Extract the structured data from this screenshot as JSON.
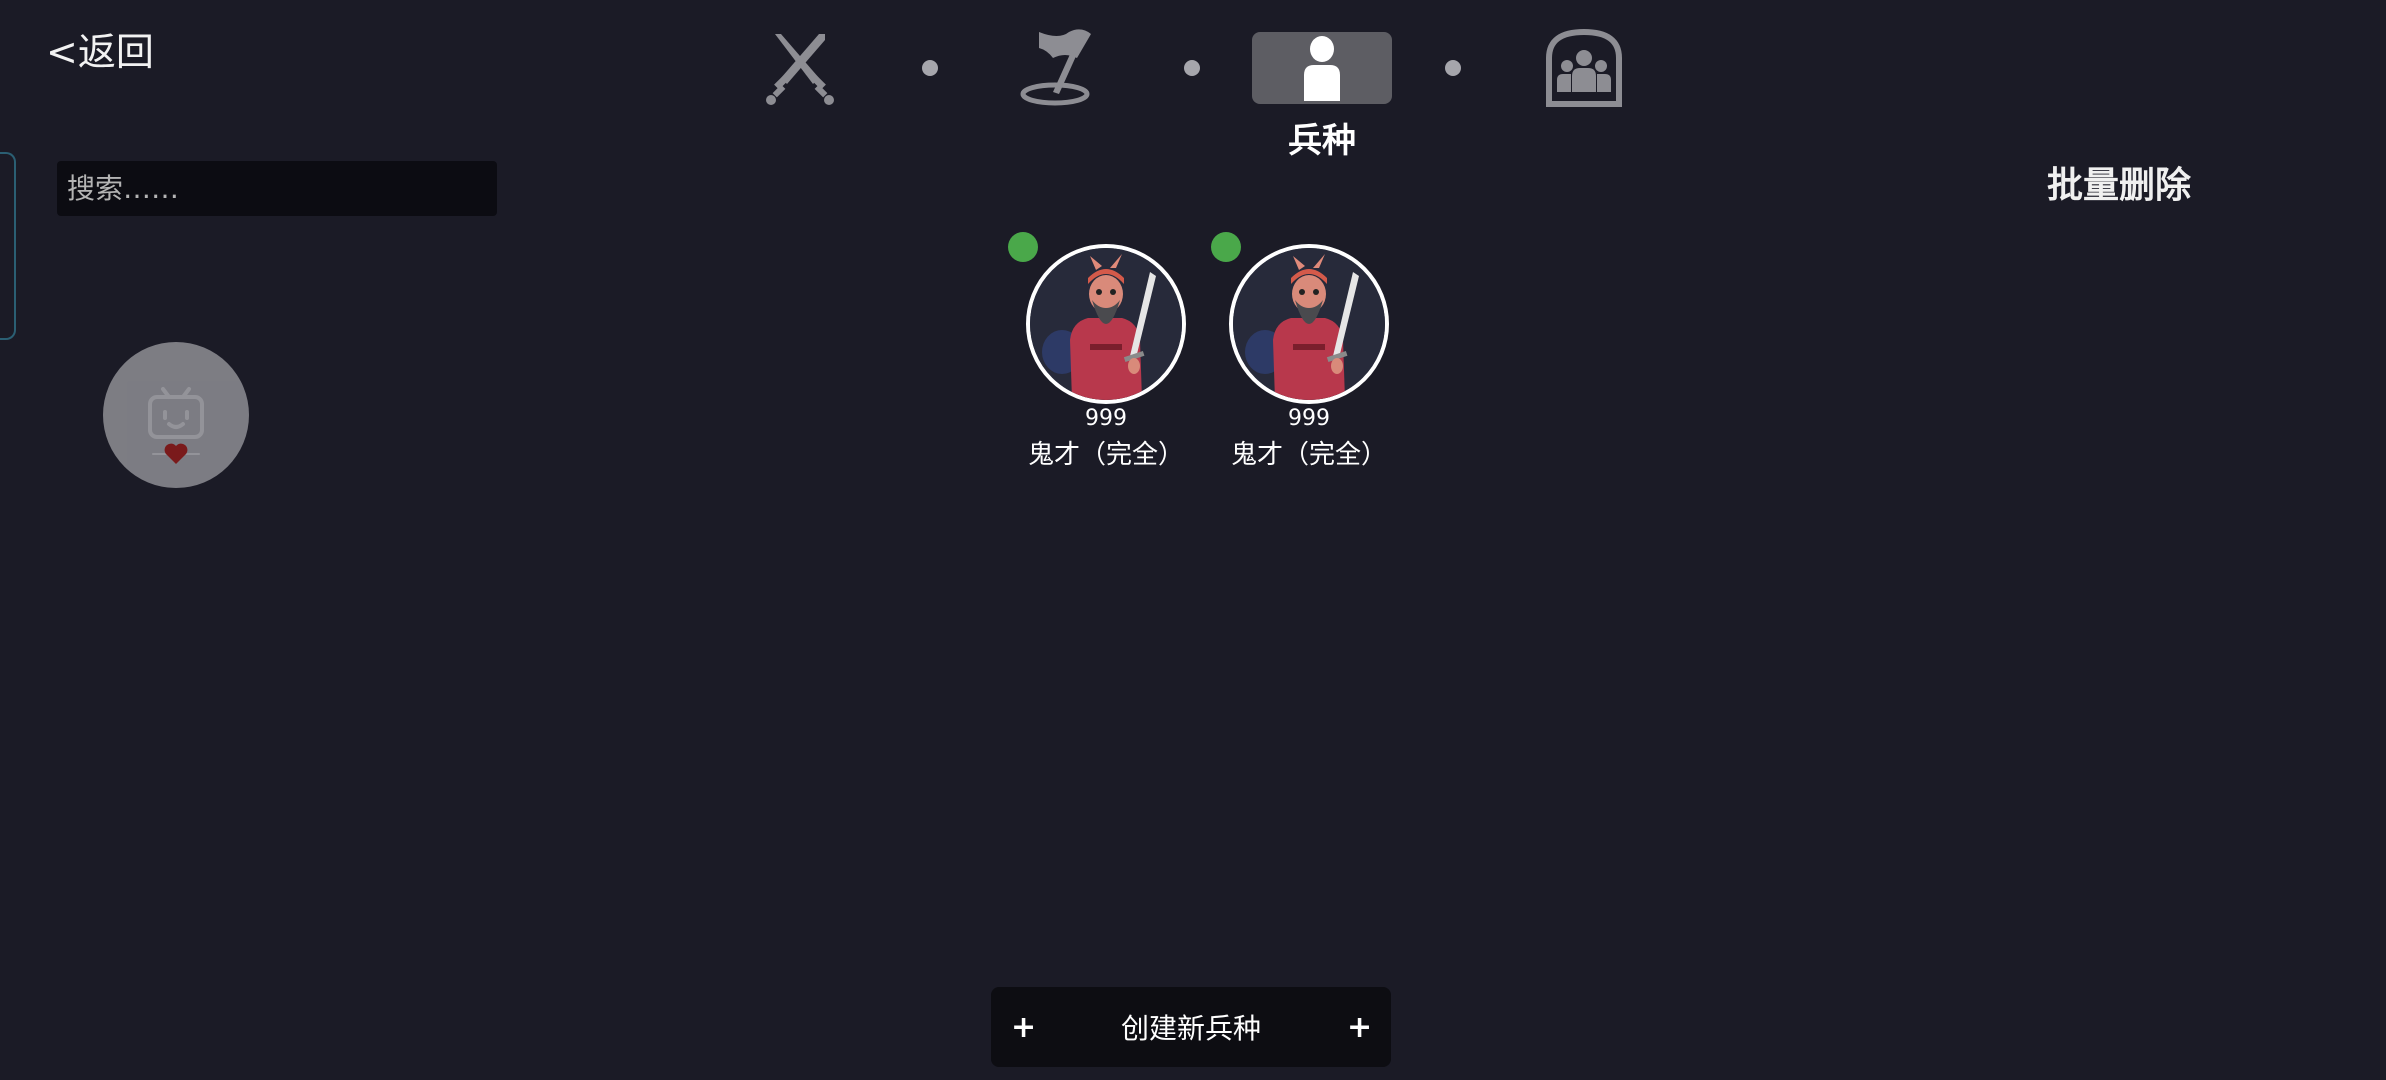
{
  "header": {
    "back_label": "<返回"
  },
  "search": {
    "placeholder": "搜索……"
  },
  "nav": {
    "items": [
      {
        "icon": "crossed-swords-icon"
      },
      {
        "icon": "flag-map-icon"
      },
      {
        "icon": "person-icon",
        "label": "兵种",
        "active": true
      },
      {
        "icon": "group-icon"
      }
    ]
  },
  "toolbar": {
    "batch_delete_label": "批量删除"
  },
  "units": [
    {
      "level": "999",
      "name": "鬼才（完全）",
      "status_color": "#4aa84a"
    },
    {
      "level": "999",
      "name": "鬼才（完全）",
      "status_color": "#4aa84a"
    }
  ],
  "create": {
    "plus_left": "+",
    "label": "创建新兵种",
    "plus_right": "+"
  },
  "colors": {
    "background": "#1b1b26",
    "status_online": "#4aa84a",
    "nav_active": "#5d5d63"
  }
}
